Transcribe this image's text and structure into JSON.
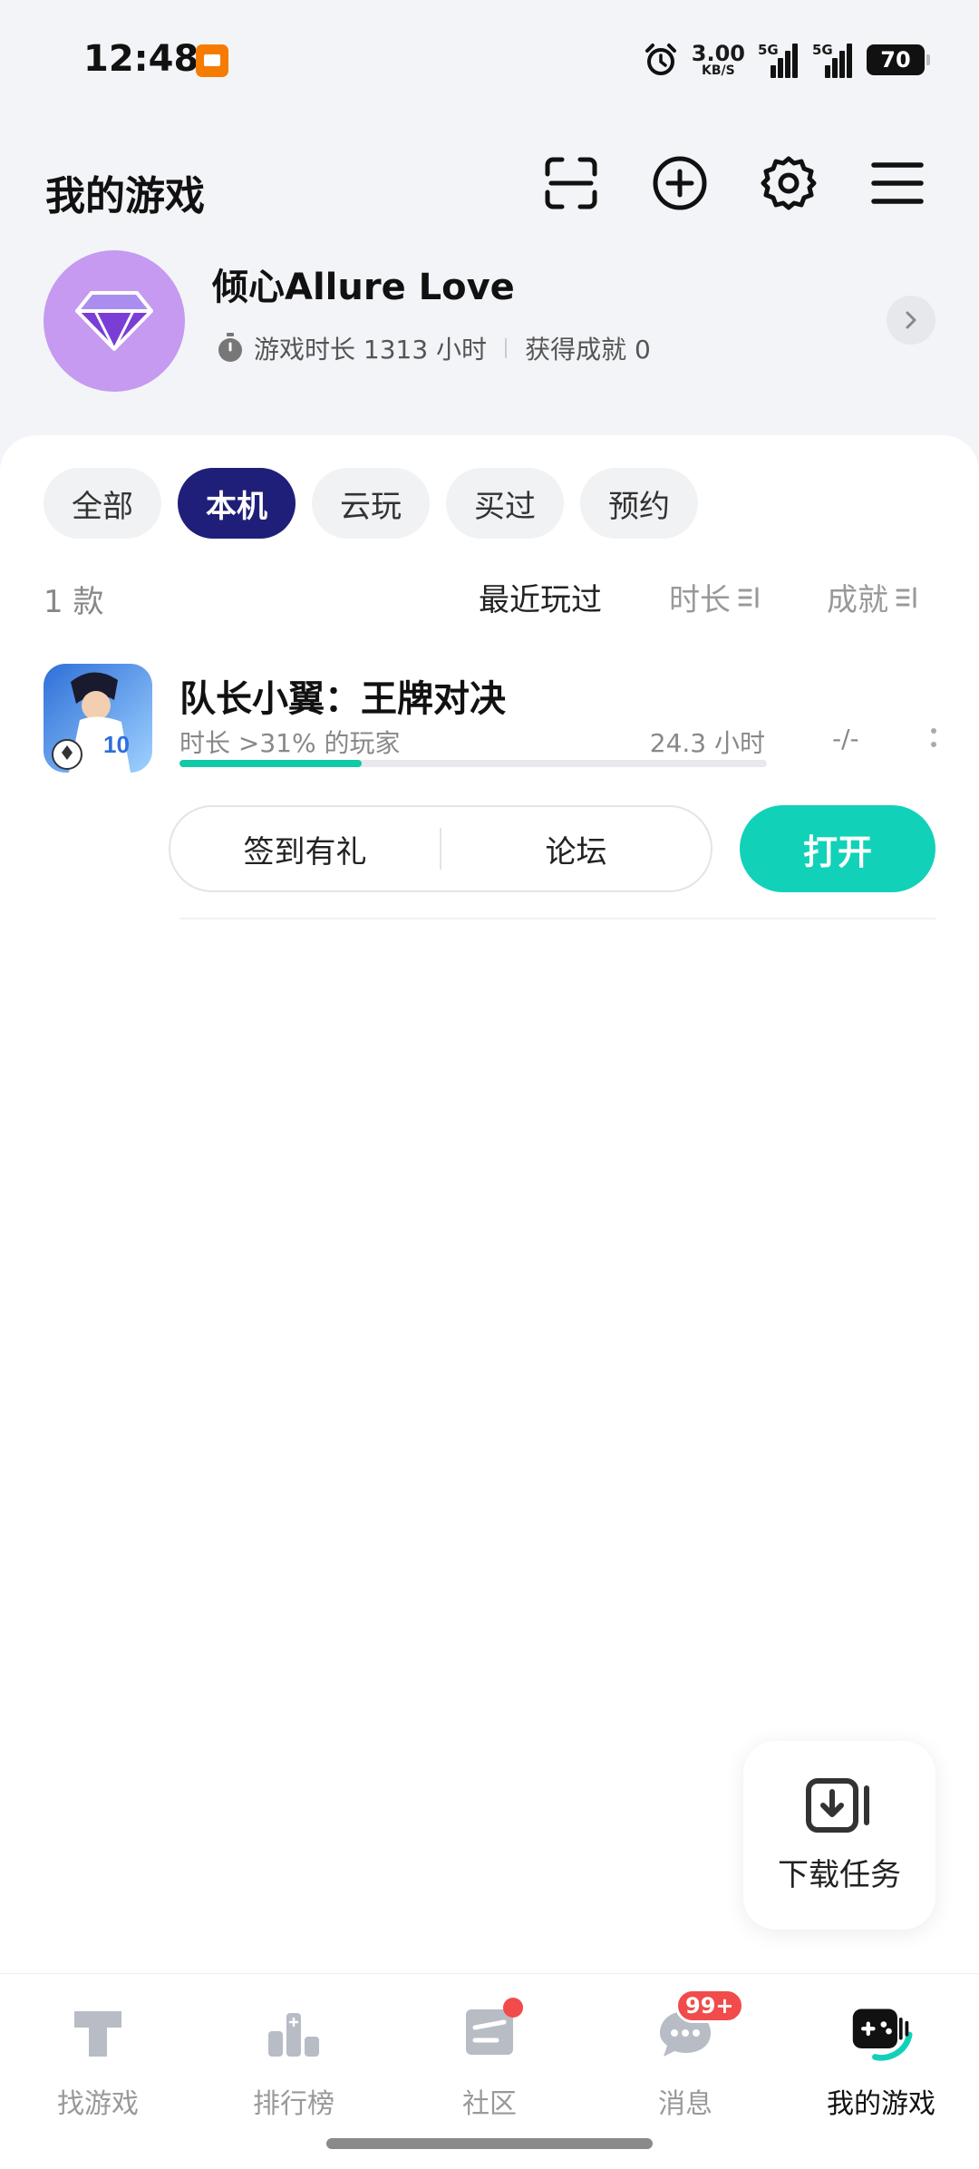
{
  "status_bar": {
    "time": "12:48",
    "net_speed_value": "3.00",
    "net_speed_unit": "KB/S",
    "signal_1_label": "5G",
    "signal_2_label": "5G",
    "battery": "70"
  },
  "header": {
    "title": "我的游戏"
  },
  "profile": {
    "username": "倾心Allure Love",
    "playtime_text": "游戏时长 1313 小时",
    "achievements_text": "获得成就 0"
  },
  "filters": {
    "chips": [
      {
        "label": "全部",
        "active": false
      },
      {
        "label": "本机",
        "active": true
      },
      {
        "label": "云玩",
        "active": false
      },
      {
        "label": "买过",
        "active": false
      },
      {
        "label": "预约",
        "active": false
      }
    ]
  },
  "list_header": {
    "count": "1 款",
    "sort_recent": "最近玩过",
    "sort_time": "时长",
    "sort_achievements": "成就"
  },
  "game": {
    "title": "队长小翼：王牌对决",
    "subtitle": "时长 >31% 的玩家",
    "hours": "24.3 小时",
    "achievements": "-/-",
    "progress": 0.31,
    "checkin_label": "签到有礼",
    "forum_label": "论坛",
    "open_label": "打开"
  },
  "download_fab": {
    "label": "下载任务"
  },
  "bottom_nav": {
    "items": [
      {
        "label": "找游戏",
        "icon": "find-games-icon"
      },
      {
        "label": "排行榜",
        "icon": "leaderboard-icon"
      },
      {
        "label": "社区",
        "icon": "community-icon"
      },
      {
        "label": "消息",
        "icon": "messages-icon",
        "badge": "99+"
      },
      {
        "label": "我的游戏",
        "icon": "my-games-icon",
        "active": true
      }
    ]
  },
  "colors": {
    "accent": "#12d1b9",
    "chip_active": "#1f1f7a",
    "badge": "#f24b4b",
    "avatar": "#c59af0"
  }
}
